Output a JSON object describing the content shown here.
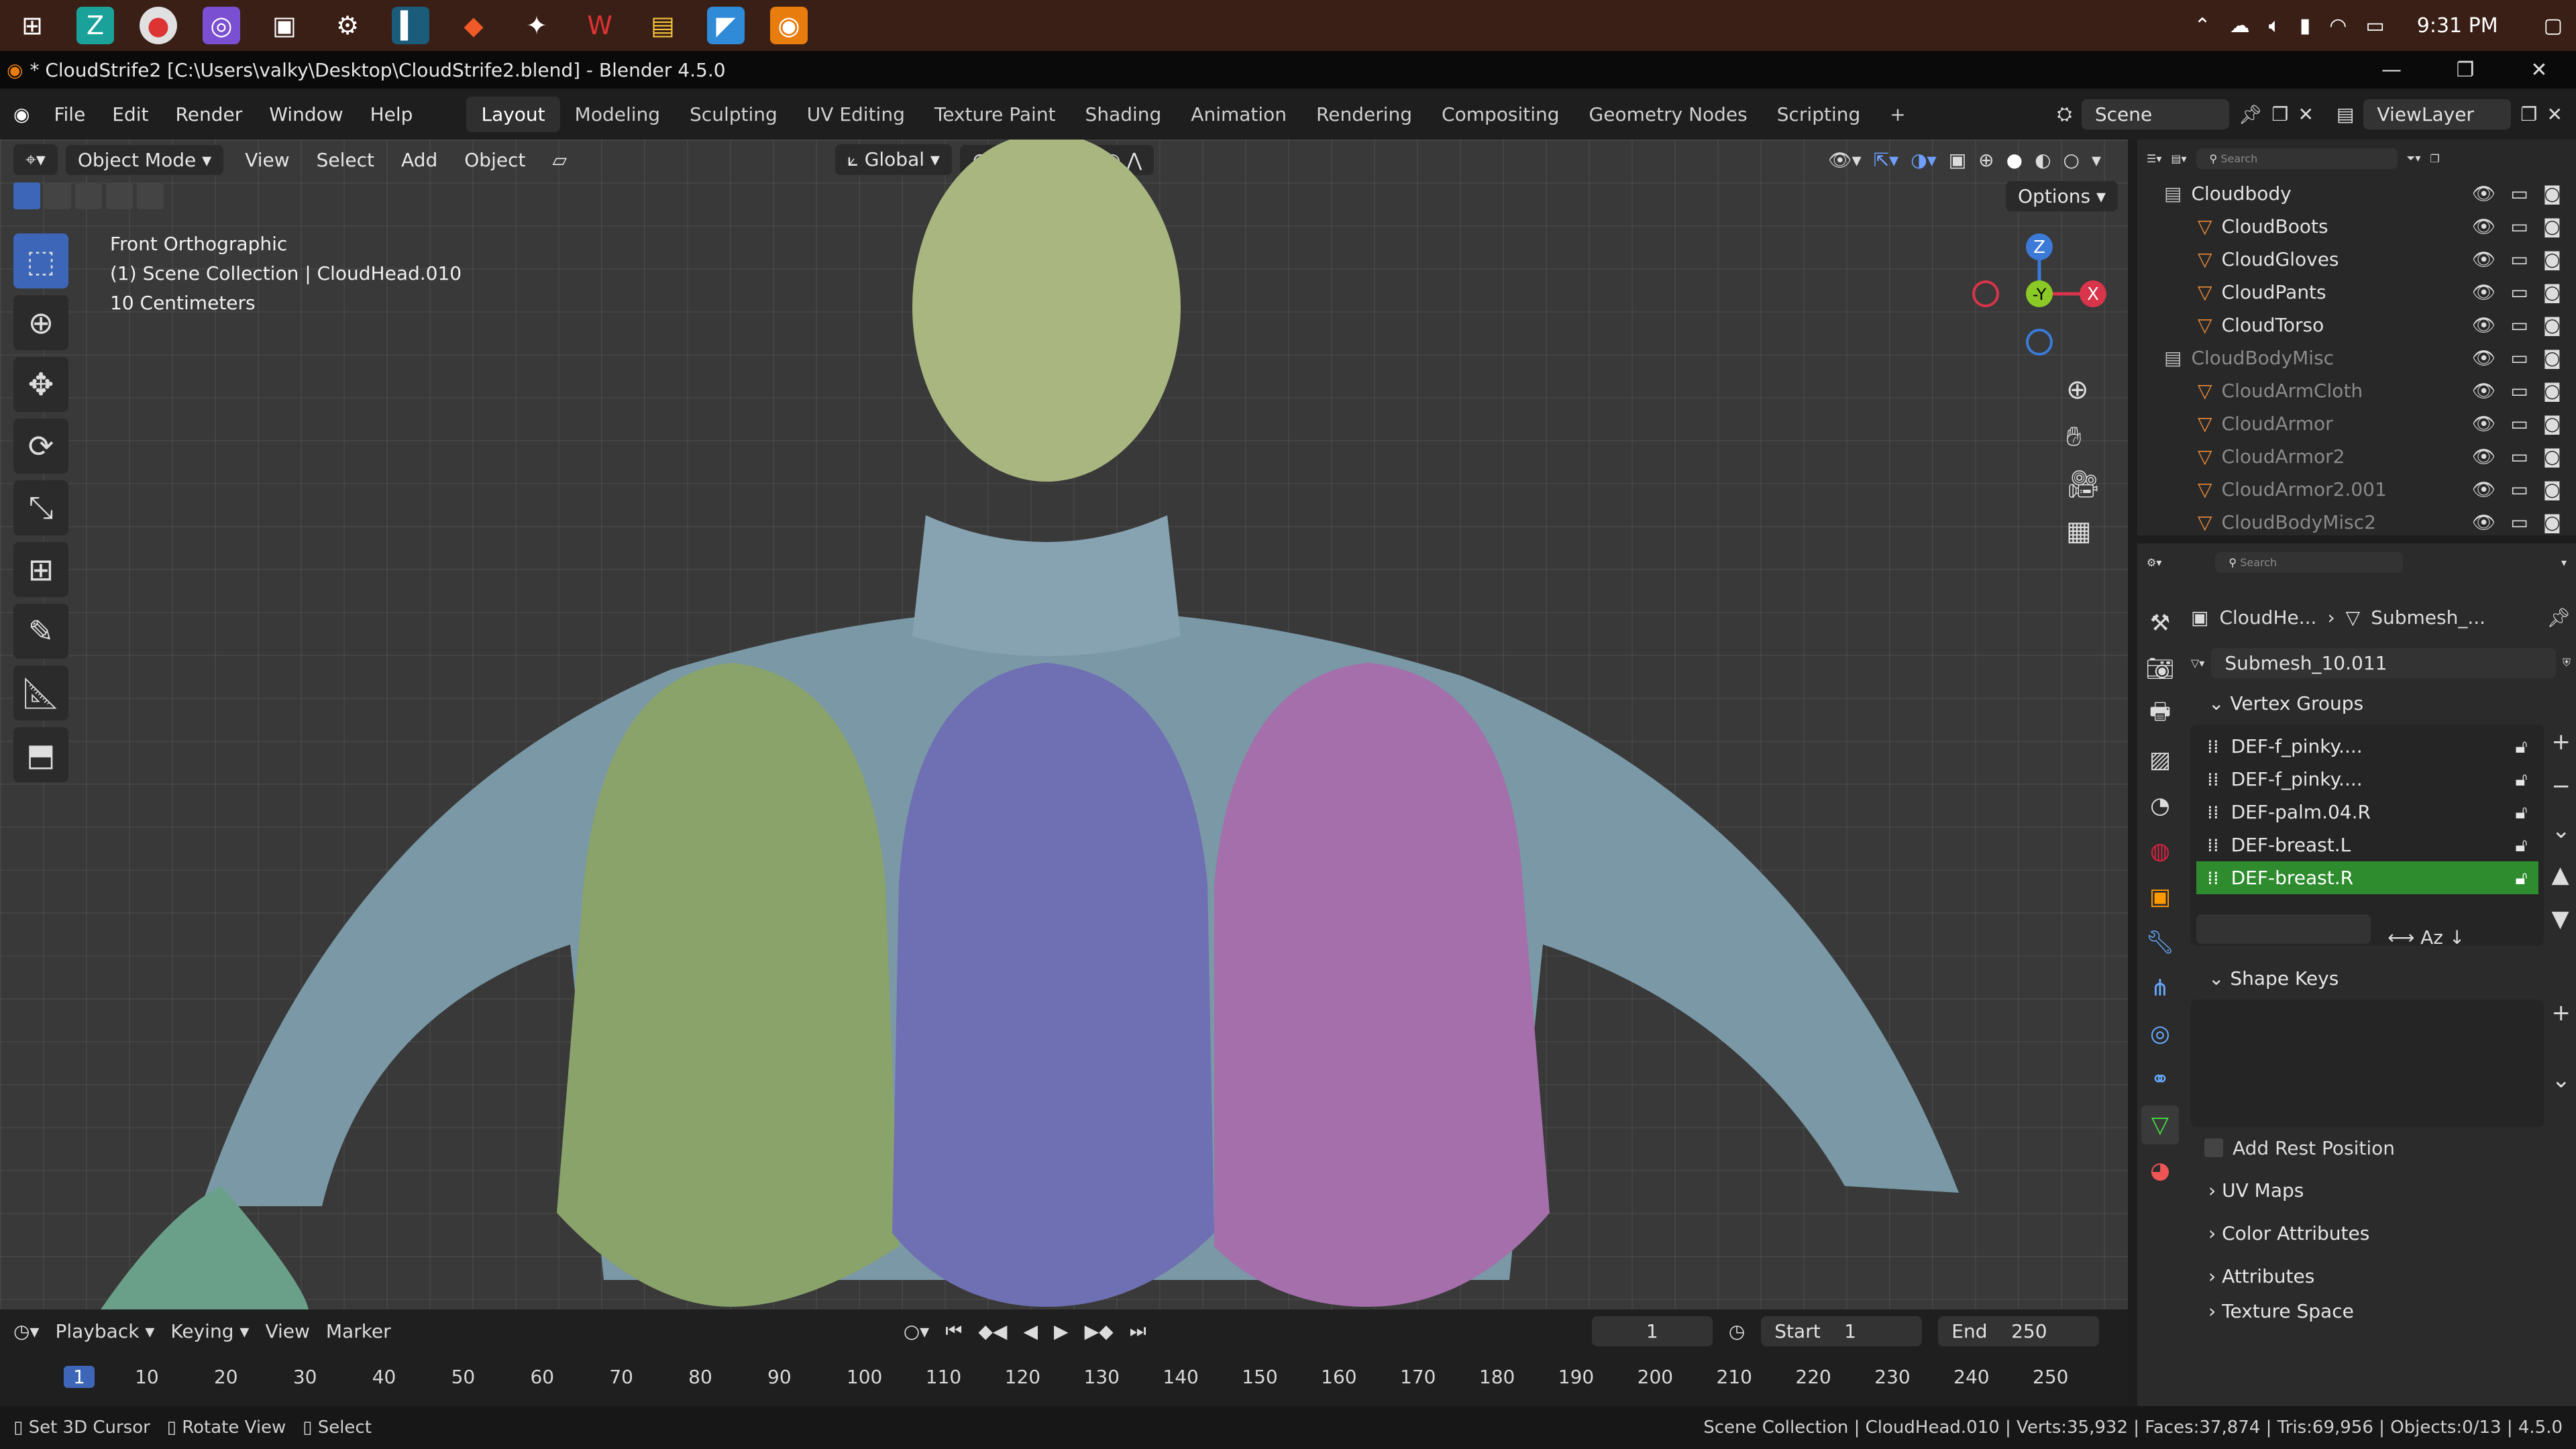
{
  "taskbar": {
    "clock": "9:31 PM"
  },
  "window": {
    "title": "* CloudStrife2 [C:\\Users\\valky\\Desktop\\CloudStrife2.blend] - Blender 4.5.0"
  },
  "menu": [
    "File",
    "Edit",
    "Render",
    "Window",
    "Help"
  ],
  "workspaces": [
    "Layout",
    "Modeling",
    "Sculpting",
    "UV Editing",
    "Texture Paint",
    "Shading",
    "Animation",
    "Rendering",
    "Compositing",
    "Geometry Nodes",
    "Scripting"
  ],
  "scene": {
    "scene_label": "Scene",
    "viewlayer_label": "ViewLayer"
  },
  "viewport": {
    "mode": "Object Mode",
    "view": "View",
    "select": "Select",
    "add": "Add",
    "object": "Object",
    "transform": "Global",
    "options": "Options",
    "info_view": "Front Orthographic",
    "info_collection": "(1) Scene Collection | CloudHead.010",
    "info_scale": "10 Centimeters"
  },
  "outliner": {
    "search_placeholder": "Search",
    "rows": [
      {
        "name": "Cloudbody",
        "dim": false
      },
      {
        "name": "CloudBoots",
        "dim": false
      },
      {
        "name": "CloudGloves",
        "dim": false
      },
      {
        "name": "CloudPants",
        "dim": false
      },
      {
        "name": "CloudTorso",
        "dim": false
      },
      {
        "name": "CloudBodyMisc",
        "dim": true
      },
      {
        "name": "CloudArmCloth",
        "dim": true
      },
      {
        "name": "CloudArmor",
        "dim": true
      },
      {
        "name": "CloudArmor2",
        "dim": true
      },
      {
        "name": "CloudArmor2.001",
        "dim": true
      },
      {
        "name": "CloudBodyMisc2",
        "dim": true
      }
    ]
  },
  "properties": {
    "search_placeholder": "Search",
    "breadcrumb_obj": "CloudHe...",
    "breadcrumb_mesh": "Submesh_...",
    "mesh_name": "Submesh_10.011",
    "vertex_groups_title": "Vertex Groups",
    "vertex_groups": [
      "DEF-f_pinky....",
      "DEF-f_pinky....",
      "DEF-palm.04.R",
      "DEF-breast.L",
      "DEF-breast.R"
    ],
    "shape_keys_title": "Shape Keys",
    "add_rest_position": "Add Rest Position",
    "uv_maps": "UV Maps",
    "color_attributes": "Color Attributes",
    "attributes": "Attributes",
    "texture_space": "Texture Space"
  },
  "timeline": {
    "playback": "Playback",
    "keying": "Keying",
    "view": "View",
    "marker": "Marker",
    "current_frame": "1",
    "start_label": "Start",
    "start": "1",
    "end_label": "End",
    "end": "250",
    "ticks": [
      "1",
      "10",
      "20",
      "30",
      "40",
      "50",
      "60",
      "70",
      "80",
      "90",
      "100",
      "110",
      "120",
      "130",
      "140",
      "150",
      "160",
      "170",
      "180",
      "190",
      "200",
      "210",
      "220",
      "230",
      "240",
      "250"
    ]
  },
  "statusbar": {
    "set_cursor": "Set 3D Cursor",
    "rotate": "Rotate View",
    "select": "Select",
    "stats": "Scene Collection | CloudHead.010 | Verts:35,932 | Faces:37,874 | Tris:69,956 | Objects:0/13 | 4.5.0"
  },
  "colors": {
    "accent": "#3d66b8",
    "selected_row": "#2e8b2e",
    "head_green": "#8aa36a",
    "head_blue": "#6f6fb3",
    "head_pink": "#a46fab",
    "torso": "#7a98a6"
  }
}
